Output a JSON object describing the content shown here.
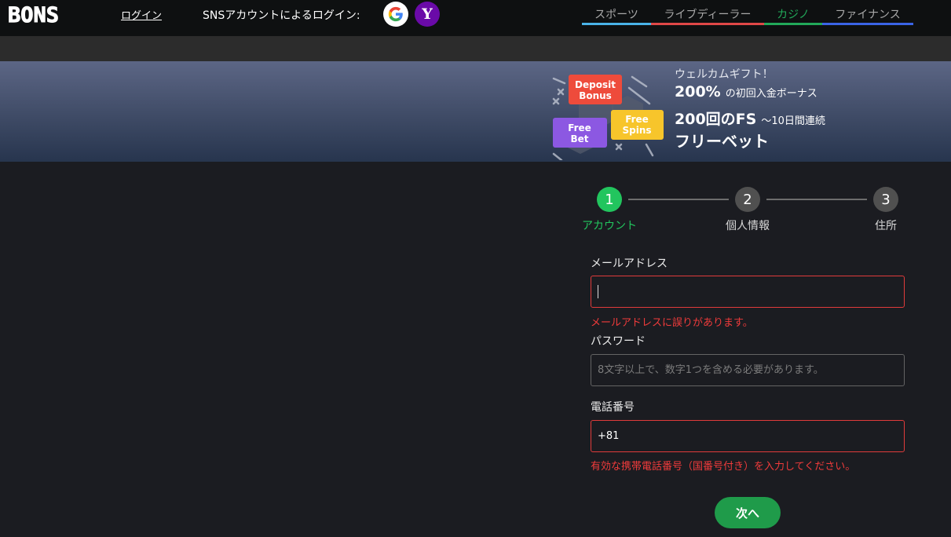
{
  "header": {
    "logo_text": "BONS",
    "login_link": "ログイン",
    "sns_login_label": "SNSアカウントによるログイン:",
    "sns_buttons": [
      {
        "icon": "google-icon",
        "label": "G"
      },
      {
        "icon": "yahoo-icon",
        "label": "Y"
      }
    ]
  },
  "nav": {
    "tabs": [
      {
        "label": "スポーツ",
        "color": "#4ab3e8",
        "text_color": "#a8a8a8"
      },
      {
        "label": "ライブディーラー",
        "color": "#e04848",
        "text_color": "#a8a8a8"
      },
      {
        "label": "カジノ",
        "color": "#22a95a",
        "text_color": "#22a95a"
      },
      {
        "label": "ファイナンス",
        "color": "#3a64e6",
        "text_color": "#a8a8a8"
      }
    ]
  },
  "promo": {
    "badges": {
      "deposit": "Deposit Bonus",
      "free_bet": "Free Bet",
      "free_spins": "Free Spins"
    },
    "welcome": "ウェルカムギフト！",
    "line1_big": "200%",
    "line1_small": "の初回入金ボーナス",
    "line2_big": "200回のFS",
    "line2_small": "～10日間連続",
    "line3": "フリーベット"
  },
  "steps": [
    {
      "number": "1",
      "label": "アカウント",
      "active": true
    },
    {
      "number": "2",
      "label": "個人情報",
      "active": false
    },
    {
      "number": "3",
      "label": "住所",
      "active": false
    }
  ],
  "form": {
    "email": {
      "label": "メールアドレス",
      "value": "",
      "error": "メールアドレスに誤りがあります。"
    },
    "password": {
      "label": "パスワード",
      "placeholder": "8文字以上で、数字1つを含める必要があります。"
    },
    "phone": {
      "label": "電話番号",
      "value": "+81",
      "error": "有効な携帯電話番号（国番号付き）を入力してください。"
    },
    "next_button": "次へ"
  },
  "colors": {
    "accent_green": "#22c55e",
    "error_red": "#f03b3b",
    "background": "#1b1c21"
  }
}
